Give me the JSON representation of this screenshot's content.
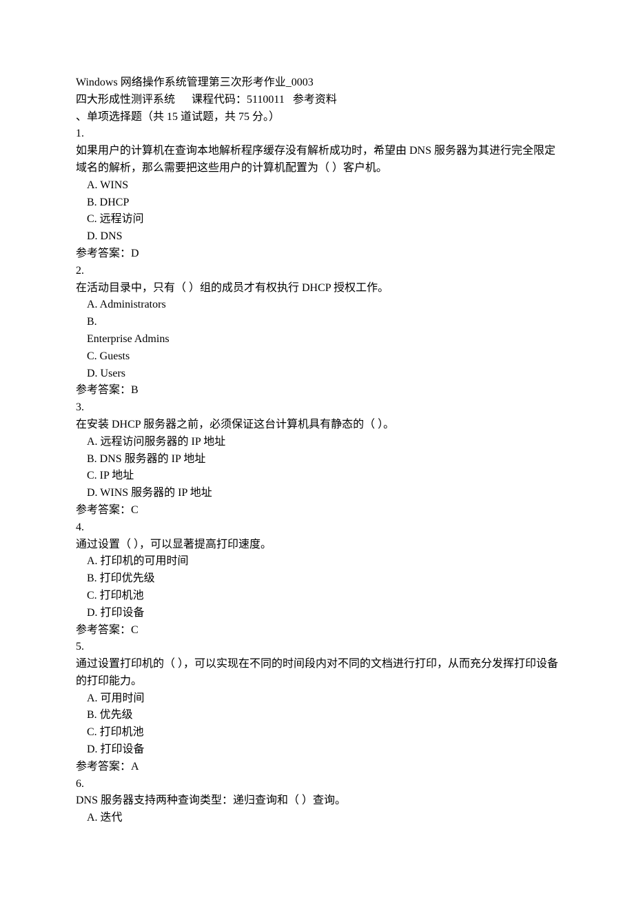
{
  "header": {
    "title_line": "Windows 网络操作系统管理第三次形考作业_0003",
    "system_line": "四大形成性测评系统      课程代码：5110011   参考资料",
    "section_title": "、单项选择题（共 15 道试题，共 75 分。）"
  },
  "questions": [
    {
      "num": "1.",
      "text": "如果用户的计算机在查询本地解析程序缓存没有解析成功时，希望由 DNS 服务器为其进行完全限定域名的解析，那么需要把这些用户的计算机配置为（    ）客户机。",
      "options": [
        "A.  WINS",
        "B.  DHCP",
        "C.  远程访问",
        "D.  DNS"
      ],
      "answer": "参考答案：D"
    },
    {
      "num": "2.",
      "text": "在活动目录中，只有（    ）组的成员才有权执行 DHCP 授权工作。",
      "options": [
        "A.   Administrators",
        "B.  ",
        "Enterprise Admins",
        "C.  Guests",
        "D.  Users"
      ],
      "answer": "参考答案：B"
    },
    {
      "num": "3.",
      "text": "在安装 DHCP 服务器之前，必须保证这台计算机具有静态的（    ）。",
      "options": [
        "A.  远程访问服务器的 IP 地址",
        "B.  DNS 服务器的 IP 地址",
        "C.  IP 地址",
        "D.  WINS 服务器的 IP 地址"
      ],
      "answer": "参考答案：C"
    },
    {
      "num": "4.",
      "text": "通过设置（    ），可以显著提高打印速度。",
      "options": [
        "A.  打印机的可用时间",
        "B.  打印优先级",
        "C.  打印机池",
        "D.  打印设备"
      ],
      "answer": "参考答案：C"
    },
    {
      "num": "5.",
      "text": "通过设置打印机的（    ），可以实现在不同的时间段内对不同的文档进行打印，从而充分发挥打印设备的打印能力。",
      "options": [
        "A.  可用时间",
        "B.  优先级",
        "C.  打印机池",
        "D.  打印设备"
      ],
      "answer": "参考答案：A"
    },
    {
      "num": "6.",
      "text": "DNS 服务器支持两种查询类型：递归查询和（    ）查询。",
      "options": [
        "A.  迭代"
      ],
      "answer": null
    }
  ]
}
